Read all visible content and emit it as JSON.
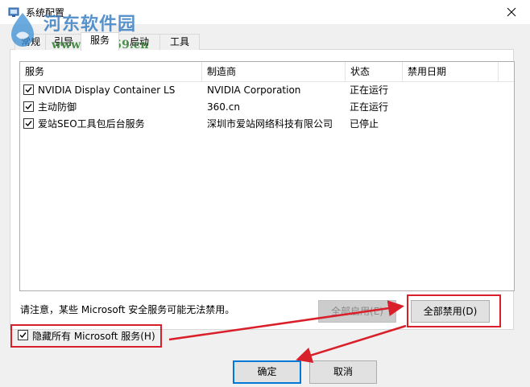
{
  "window": {
    "title": "系统配置",
    "accent": "#0078d7"
  },
  "watermark": {
    "site_name": "河东软件园",
    "url": "www.pc0359.cn"
  },
  "tabs": [
    {
      "label": "常规",
      "active": false
    },
    {
      "label": "引导",
      "active": false
    },
    {
      "label": "服务",
      "active": true
    },
    {
      "label": "启动",
      "active": false
    },
    {
      "label": "工具",
      "active": false
    }
  ],
  "services_table": {
    "columns": [
      "服务",
      "制造商",
      "状态",
      "禁用日期"
    ],
    "rows": [
      {
        "checked": true,
        "service": "NVIDIA Display Container LS",
        "manufacturer": "NVIDIA Corporation",
        "status": "正在运行",
        "disabled_date": ""
      },
      {
        "checked": true,
        "service": "主动防御",
        "manufacturer": "360.cn",
        "status": "正在运行",
        "disabled_date": ""
      },
      {
        "checked": true,
        "service": "爱站SEO工具包后台服务",
        "manufacturer": "深圳市爱站网络科技有限公司",
        "status": "已停止",
        "disabled_date": ""
      }
    ]
  },
  "note": "请注意，某些 Microsoft 安全服务可能无法禁用。",
  "buttons": {
    "enable_all": "全部启用(E)",
    "disable_all": "全部禁用(D)",
    "ok": "确定",
    "cancel": "取消"
  },
  "hide_microsoft": {
    "label": "隐藏所有 Microsoft 服务(H)",
    "checked": true
  },
  "annotation_color": "#d9202a"
}
